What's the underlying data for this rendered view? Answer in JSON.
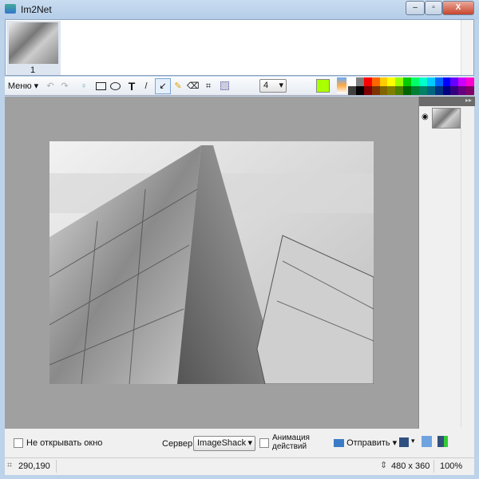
{
  "window": {
    "title": "Im2Net",
    "minimize": "–",
    "maximize": "▫",
    "close": "X"
  },
  "thumbnails": [
    {
      "label": "1"
    }
  ],
  "toolbar": {
    "menu_label": "Меню",
    "brush_size": "4",
    "current_color": "#aaff00",
    "palette_top": [
      "#ffffff",
      "#808080",
      "#ff0000",
      "#ff6600",
      "#ffcc00",
      "#ffff00",
      "#99ff00",
      "#00cc00",
      "#00ff66",
      "#00ffcc",
      "#00ccff",
      "#0066ff",
      "#0000ff",
      "#6600ff",
      "#cc00ff",
      "#ff00cc"
    ],
    "palette_bottom": [
      "#404040",
      "#000000",
      "#800000",
      "#803300",
      "#806600",
      "#808000",
      "#4c8000",
      "#006600",
      "#008033",
      "#008066",
      "#006680",
      "#003380",
      "#000080",
      "#330080",
      "#660080",
      "#800066"
    ]
  },
  "bottom": {
    "no_open_label": "Не открывать окно",
    "server_label": "Сервер",
    "server_value": "ImageShack",
    "animation_label_1": "Анимация",
    "animation_label_2": "действий",
    "send_label": "Отправить"
  },
  "status": {
    "coords": "290,190",
    "size": "480 x 360",
    "zoom": "100%"
  }
}
